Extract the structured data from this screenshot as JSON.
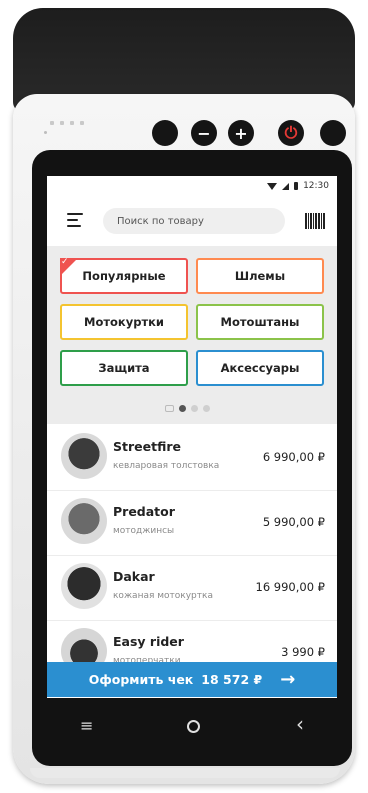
{
  "status": {
    "time": "12:30"
  },
  "search": {
    "placeholder": "Поиск по товару"
  },
  "categories": [
    {
      "label": "Популярные",
      "color": "#ef5350",
      "selected": true
    },
    {
      "label": "Шлемы",
      "color": "#ff8a50"
    },
    {
      "label": "Мотокуртки",
      "color": "#f4c430"
    },
    {
      "label": "Мотоштаны",
      "color": "#8bc34a"
    },
    {
      "label": "Защита",
      "color": "#2e9e4a"
    },
    {
      "label": "Аксессуары",
      "color": "#2b8fd0"
    }
  ],
  "products": [
    {
      "name": "Streetfire",
      "desc": "кевларовая толстовка",
      "price": "6 990,00 ₽"
    },
    {
      "name": "Predator",
      "desc": "мотоджинсы",
      "price": "5 990,00 ₽"
    },
    {
      "name": "Dakar",
      "desc": "кожаная мотокуртка",
      "price": "16 990,00 ₽"
    },
    {
      "name": "Easy rider",
      "desc": "мотоперчатки",
      "price": "3 990 ₽"
    }
  ],
  "checkout": {
    "label": "Оформить чек",
    "total": "18 572 ₽",
    "color": "#2b8fd0"
  },
  "hardware": {
    "minus": "−",
    "plus": "+",
    "power": "⏻"
  },
  "navbar": {
    "menu": "≡",
    "back": "‹"
  }
}
